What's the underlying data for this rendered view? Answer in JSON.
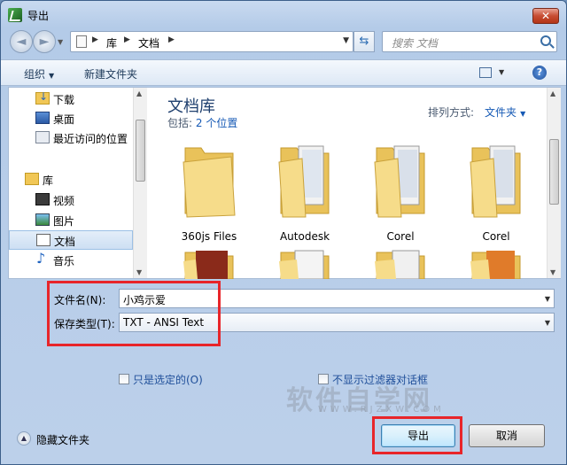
{
  "window": {
    "title": "导出",
    "close_label": "✕"
  },
  "nav": {
    "back_icon": "◄",
    "forward_icon": "►",
    "address": {
      "crumbs": [
        "库",
        "文档"
      ]
    },
    "search_placeholder": "搜索 文档"
  },
  "toolbar": {
    "organize": "组织",
    "new_folder": "新建文件夹",
    "help": "?"
  },
  "sidebar": {
    "items": [
      {
        "label": "下载",
        "icon": "download-folder-icon"
      },
      {
        "label": "桌面",
        "icon": "desktop-icon"
      },
      {
        "label": "最近访问的位置",
        "icon": "recent-places-icon"
      },
      {
        "label": "库",
        "icon": "library-icon"
      },
      {
        "label": "视频",
        "icon": "video-library-icon"
      },
      {
        "label": "图片",
        "icon": "picture-library-icon"
      },
      {
        "label": "文档",
        "icon": "document-library-icon"
      },
      {
        "label": "音乐",
        "icon": "music-library-icon"
      }
    ]
  },
  "content": {
    "library_title": "文档库",
    "includes_label": "包括:",
    "includes_link": "2 个位置",
    "arrange_label": "排列方式:",
    "arrange_value": "文件夹",
    "folders": [
      {
        "name": "360js Files"
      },
      {
        "name": "Autodesk"
      },
      {
        "name": "Corel"
      },
      {
        "name": "Corel"
      },
      {
        "name": ""
      },
      {
        "name": ""
      },
      {
        "name": ""
      },
      {
        "name": ""
      }
    ]
  },
  "form": {
    "filename_label": "文件名(N):",
    "filename_value": "小鸡示爱",
    "filetype_label": "保存类型(T):",
    "filetype_value": "TXT - ANSI Text",
    "only_selected": "只是选定的(O)",
    "no_filter_dialog": "不显示过滤器对话框"
  },
  "watermark": {
    "text": "软件自学网",
    "sub": "WWW.RJZXW.COM"
  },
  "footer": {
    "hide_folders": "隐藏文件夹",
    "export_button": "导出",
    "cancel_button": "取消"
  },
  "colors": {
    "highlight_box": "#e8252a",
    "link": "#1559b5"
  }
}
